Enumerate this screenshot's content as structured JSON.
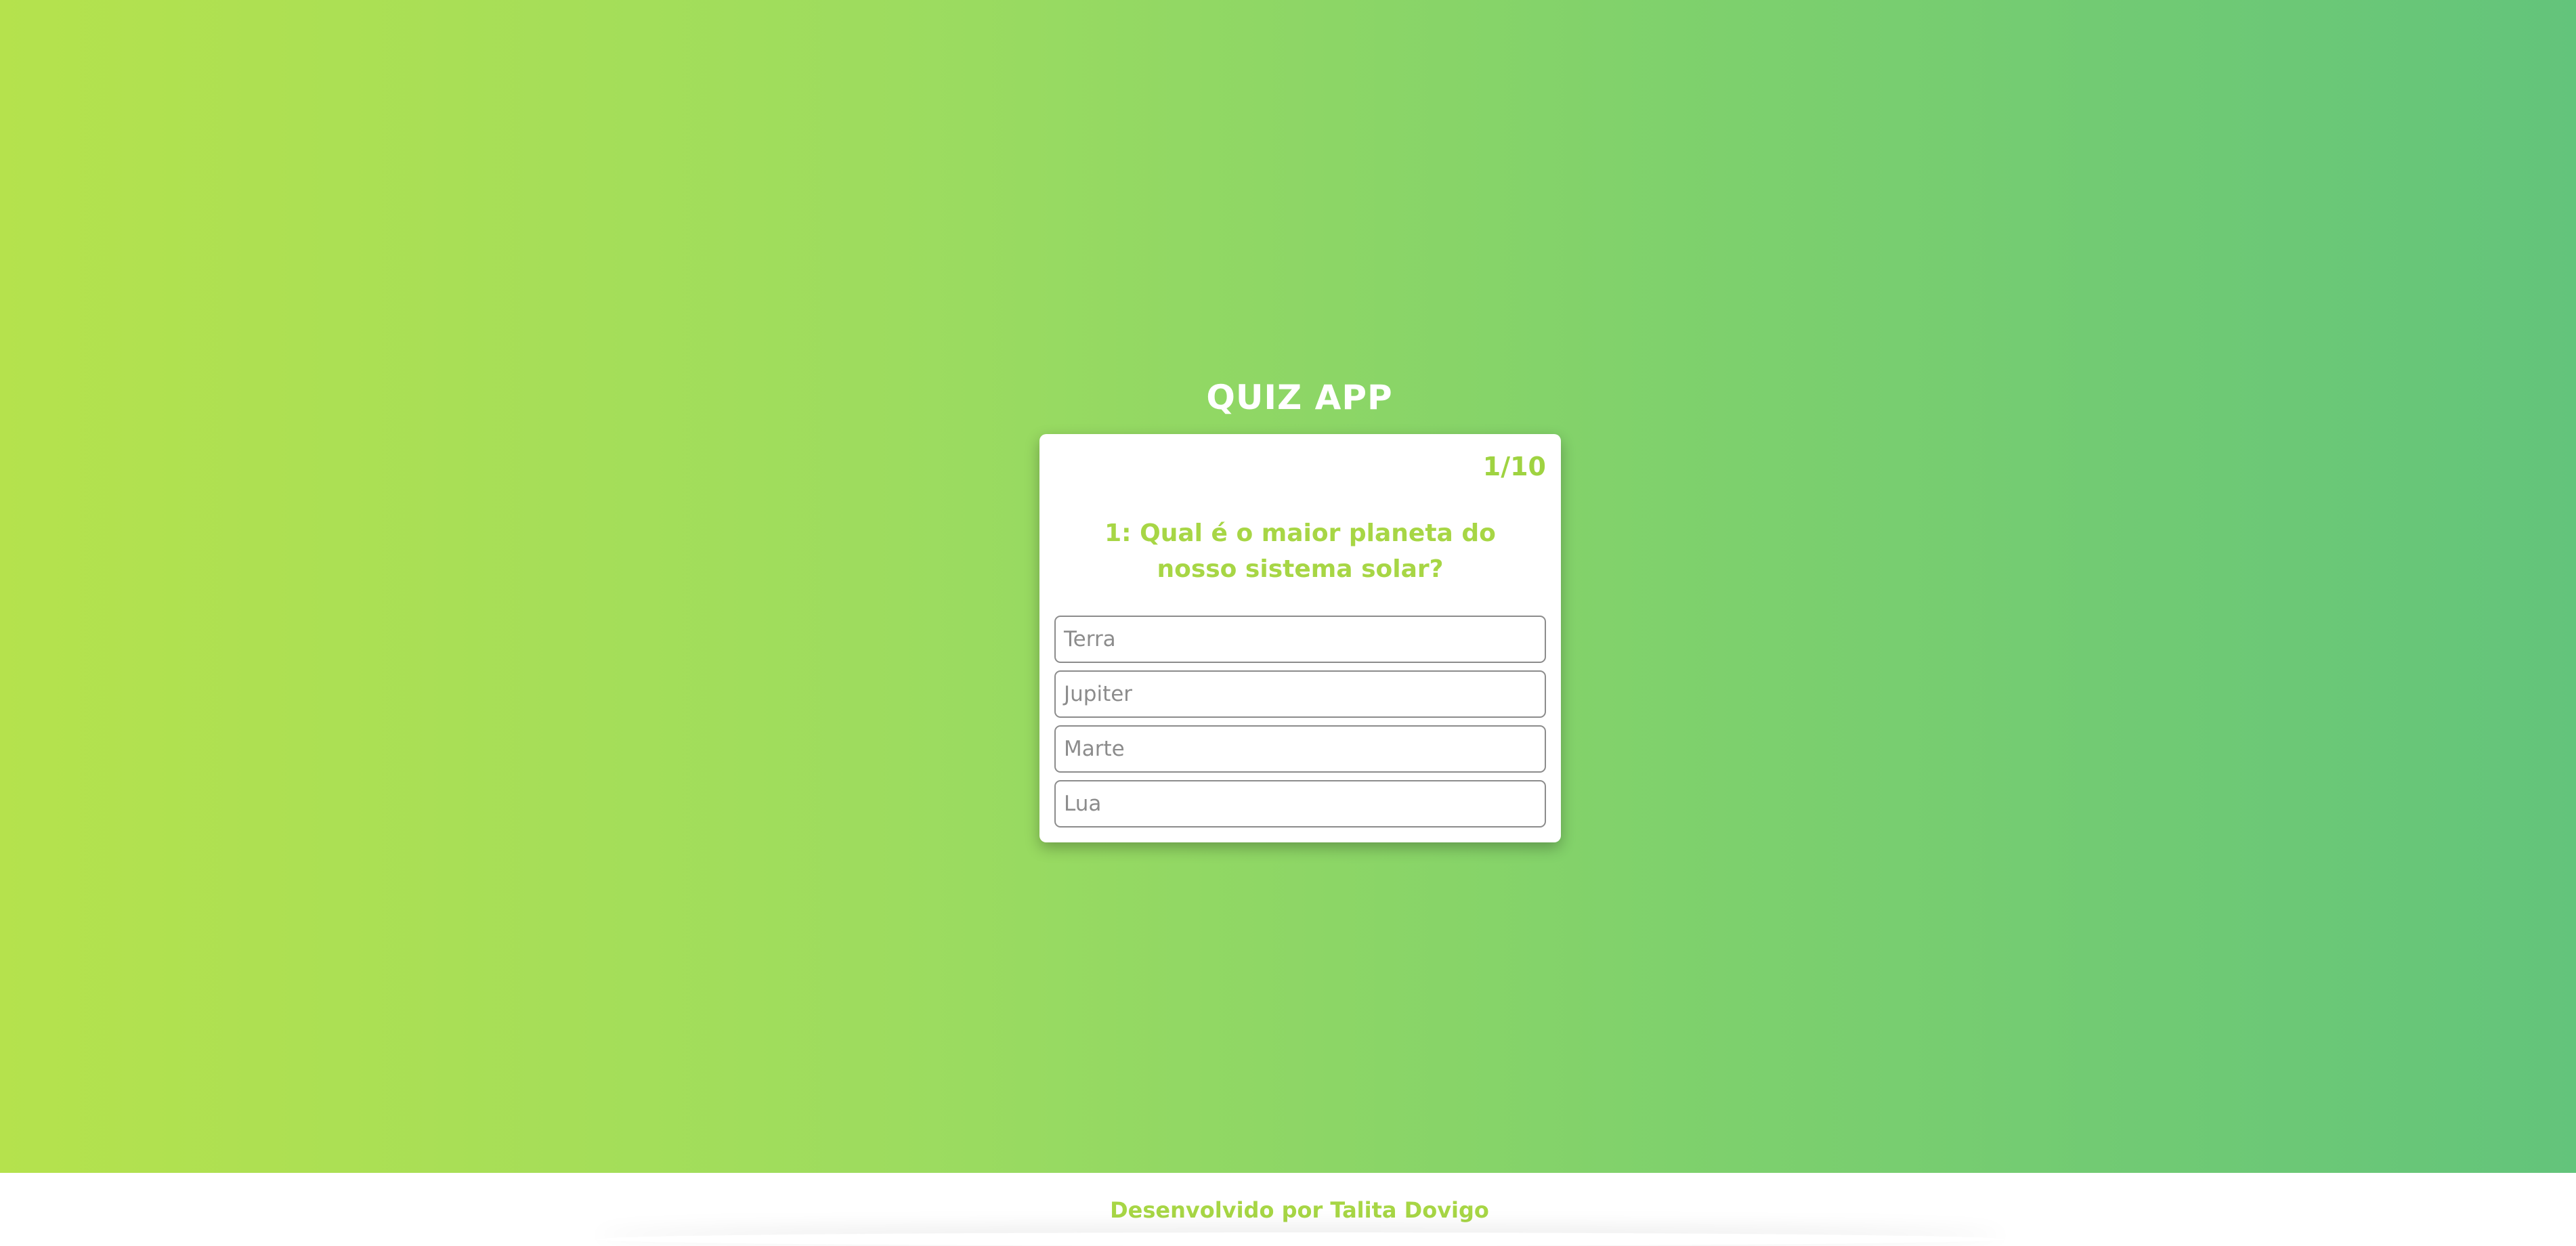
{
  "app": {
    "title": "QUIZ APP"
  },
  "quiz": {
    "counter": "1/10",
    "question": "1: Qual é o maior planeta do nosso sistema solar?",
    "options": [
      {
        "label": "Terra"
      },
      {
        "label": "Jupiter"
      },
      {
        "label": "Marte"
      },
      {
        "label": "Lua"
      }
    ]
  },
  "footer": {
    "credit": "Desenvolvido por Talita Dovigo"
  },
  "colors": {
    "accent": "#a7d645",
    "gradient_start": "#b5e24d",
    "gradient_end": "#63c47b",
    "option_border": "#8c8c8c"
  }
}
